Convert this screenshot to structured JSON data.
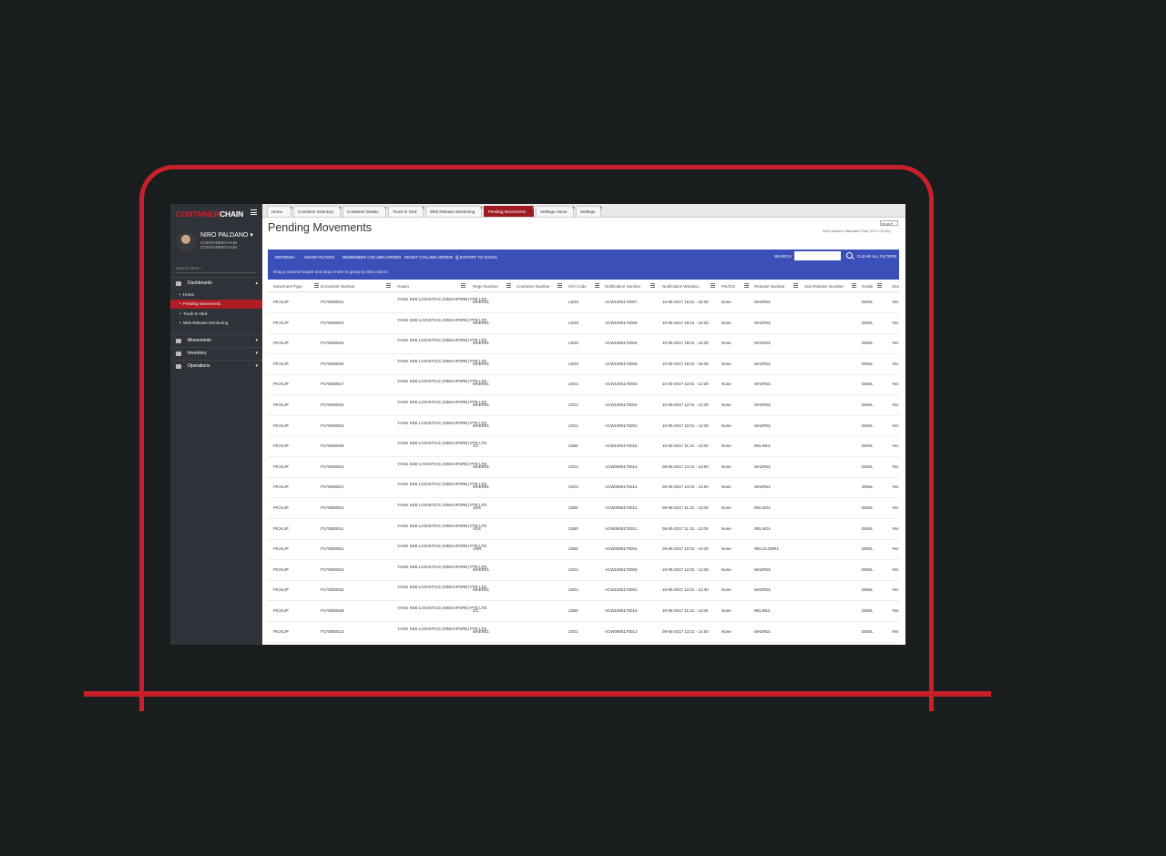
{
  "app": {
    "logo_part1": "CONTAINER",
    "logo_part2": "CHAIN"
  },
  "user": {
    "name": "NIRO PALDANO",
    "org_line1": "CONTAINERCHAIN",
    "org_line2": "CONTAINERCHAIN"
  },
  "sidebar": {
    "search_placeholder": "Search Menu...",
    "sections": [
      {
        "label": "Dashboards",
        "icon": "dashboard-icon",
        "expanded": true
      },
      {
        "label": "Movements",
        "icon": "truck-icon"
      },
      {
        "label": "Inventory",
        "icon": "list-icon"
      },
      {
        "label": "Operations",
        "icon": "cogs-icon"
      }
    ],
    "submenu": [
      "Home",
      "Pending Movements",
      "Truck In Yard",
      "Web Release Monitoring"
    ],
    "active_submenu": "Pending Movements"
  },
  "tabs": [
    "Home",
    "Container Inventory",
    "Container Details",
    "Truck In Yard",
    "Web Release Monitoring",
    "Pending Movements",
    "Settings Home",
    "Settings"
  ],
  "active_tab": "Pending Movements",
  "page": {
    "title": "Pending Movements",
    "locale": "en-us",
    "timezone": "AUS Eastern Standard Time (UTC+10:00)"
  },
  "toolbar": {
    "refresh": "REFRESH",
    "show_filters": "SHOW FILTERS",
    "remember_order": "REMEMBER COLUMN ORDER",
    "reset_order": "RESET COLUMN ORDER",
    "export": "EXPORT TO EXCEL",
    "search_label": "SEARCH",
    "clear_filters": "CLEAR ALL FILTERS",
    "group_hint": "Drag a column header and drop it here to group by that column"
  },
  "grid": {
    "columns": [
      "Movement Type",
      "Document Number",
      "Hauler",
      "Rego Number",
      "Container Number",
      "ISO Code",
      "Notification Number",
      "Notification Window",
      "PG/ICS",
      "Release Number",
      "Sub Release Number",
      "Grade",
      "Slot"
    ],
    "sorted_column": "Notification Window",
    "rows": [
      [
        "PICKUP",
        "P170500021",
        "YANG KEE LOGISTICS (SINGAPORE) PTE LTD",
        "MAER01",
        "",
        "L5G0",
        "ACW1005170007",
        "10-05-2017 16:01 - 16:30",
        "None",
        "MAER01",
        "",
        "DMSL",
        "Yes"
      ],
      [
        "PICKUP",
        "P170500019",
        "YANG KEE LOGISTICS (SINGAPORE) PTE LTD",
        "MAER01",
        "",
        "L5G0",
        "ACW1005170005",
        "10-05-2017 16:01 - 16:30",
        "None",
        "MAER01",
        "",
        "DMSL",
        "Yes"
      ],
      [
        "PICKUP",
        "P170500018",
        "YANG KEE LOGISTICS (SINGAPORE) PTE LTD",
        "MAER01",
        "",
        "L5G0",
        "ACW1005170004",
        "10-05-2017 16:01 - 16:30",
        "None",
        "MAER01",
        "",
        "DMSL",
        "Yes"
      ],
      [
        "PICKUP",
        "P170500020",
        "YANG KEE LOGISTICS (SINGAPORE) PTE LTD",
        "MAER01",
        "",
        "L5G0",
        "ACW1005170006",
        "10-05-2017 16:01 - 16:30",
        "None",
        "MAER01",
        "",
        "DMSL",
        "Yes"
      ],
      [
        "PICKUP",
        "P170500017",
        "YANG KEE LOGISTICS (SINGAPORE) PTE LTD",
        "MAER01",
        "",
        "22G1",
        "ACW1005170003",
        "10-05-2017 12:01 - 12:30",
        "None",
        "MAER01",
        "",
        "DMSL",
        "Yes"
      ],
      [
        "PICKUP",
        "P170500016",
        "YANG KEE LOGISTICS (SINGAPORE) PTE LTD",
        "MAER01",
        "",
        "22G1",
        "ACW1005170002",
        "10-05-2017 12:01 - 12:30",
        "None",
        "MAER01",
        "",
        "DMSL",
        "Yes"
      ],
      [
        "PICKUP",
        "P170500015",
        "YANG KEE LOGISTICS (SINGAPORE) PTE LTD",
        "MAER01",
        "",
        "22G1",
        "ACW1005170001",
        "10-05-2017 12:01 - 12:30",
        "None",
        "MAER01",
        "",
        "DMSL",
        "Yes"
      ],
      [
        "PICKUP",
        "P170500029",
        "YANG KEE LOGISTICS (SINGAPORE) PTE LTD",
        "CC",
        "",
        "22B0",
        "ACW1005170015",
        "10-05-2017 11:31 - 12:00",
        "None",
        "RELRE4",
        "",
        "DMSL",
        "Yes"
      ],
      [
        "PICKUP",
        "P170500013",
        "YANG KEE LOGISTICS (SINGAPORE) PTE LTD",
        "MAER01",
        "",
        "22G1",
        "ACW0905170013",
        "09-05-2017 13:31 - 14:00",
        "None",
        "MAER01",
        "",
        "DMSL",
        "Yes"
      ],
      [
        "PICKUP",
        "P170500014",
        "YANG KEE LOGISTICS (SINGAPORE) PTE LTD",
        "MAER01",
        "",
        "22G1",
        "ACW0905170014",
        "09-05-2017 13:31 - 14:00",
        "None",
        "MAER01",
        "",
        "DMSL",
        "Yes"
      ],
      [
        "PICKUP",
        "P170500012",
        "YANG KEE LOGISTICS (SINGAPORE) PTE LTD",
        "XXX",
        "",
        "22B0",
        "ACW0905170012",
        "09-05-2017 11:31 - 12:00",
        "None",
        "RELNO1",
        "",
        "DMSL",
        "Yes"
      ],
      [
        "PICKUP",
        "P170500011",
        "YANG KEE LOGISTICS (SINGAPORE) PTE LTD",
        "XXX",
        "",
        "22B0",
        "ACW0905170011",
        "09-05-2017 11:31 - 12:00",
        "None",
        "RELNO1",
        "",
        "DMSL",
        "Yes"
      ],
      [
        "PICKUP",
        "P170500001",
        "YANG KEE LOGISTICS (SINGAPORE) PTE LTD",
        "ASR",
        "",
        "22B0",
        "ACW0905170001",
        "09-05-2017 10:01 - 10:30",
        "None",
        "RELCLONR1",
        "",
        "DMSL",
        "Yes"
      ],
      [
        "PICKUP",
        "P170500016",
        "YANG KEE LOGISTICS (SINGAPORE) PTE LTD",
        "MAER01",
        "",
        "22G1",
        "ACW1005170002",
        "10-05-2017 12:01 - 12:30",
        "None",
        "MAER01",
        "",
        "DMSL",
        "Yes"
      ],
      [
        "PICKUP",
        "P170500015",
        "YANG KEE LOGISTICS (SINGAPORE) PTE LTD",
        "MAER01",
        "",
        "22G1",
        "ACW1005170001",
        "10-05-2017 12:01 - 12:30",
        "None",
        "MAER01",
        "",
        "DMSL",
        "Yes"
      ],
      [
        "PICKUP",
        "P170500029",
        "YANG KEE LOGISTICS (SINGAPORE) PTE LTD",
        "CC",
        "",
        "22B0",
        "ACW1005170015",
        "10-05-2017 11:31 - 12:00",
        "None",
        "RELRE4",
        "",
        "DMSL",
        "Yes"
      ],
      [
        "PICKUP",
        "P170500013",
        "YANG KEE LOGISTICS (SINGAPORE) PTE LTD",
        "MAER01",
        "",
        "22G1",
        "ACW0905170013",
        "09-05-2017 13:31 - 14:00",
        "None",
        "MAER01",
        "",
        "DMSL",
        "Yes"
      ]
    ]
  }
}
